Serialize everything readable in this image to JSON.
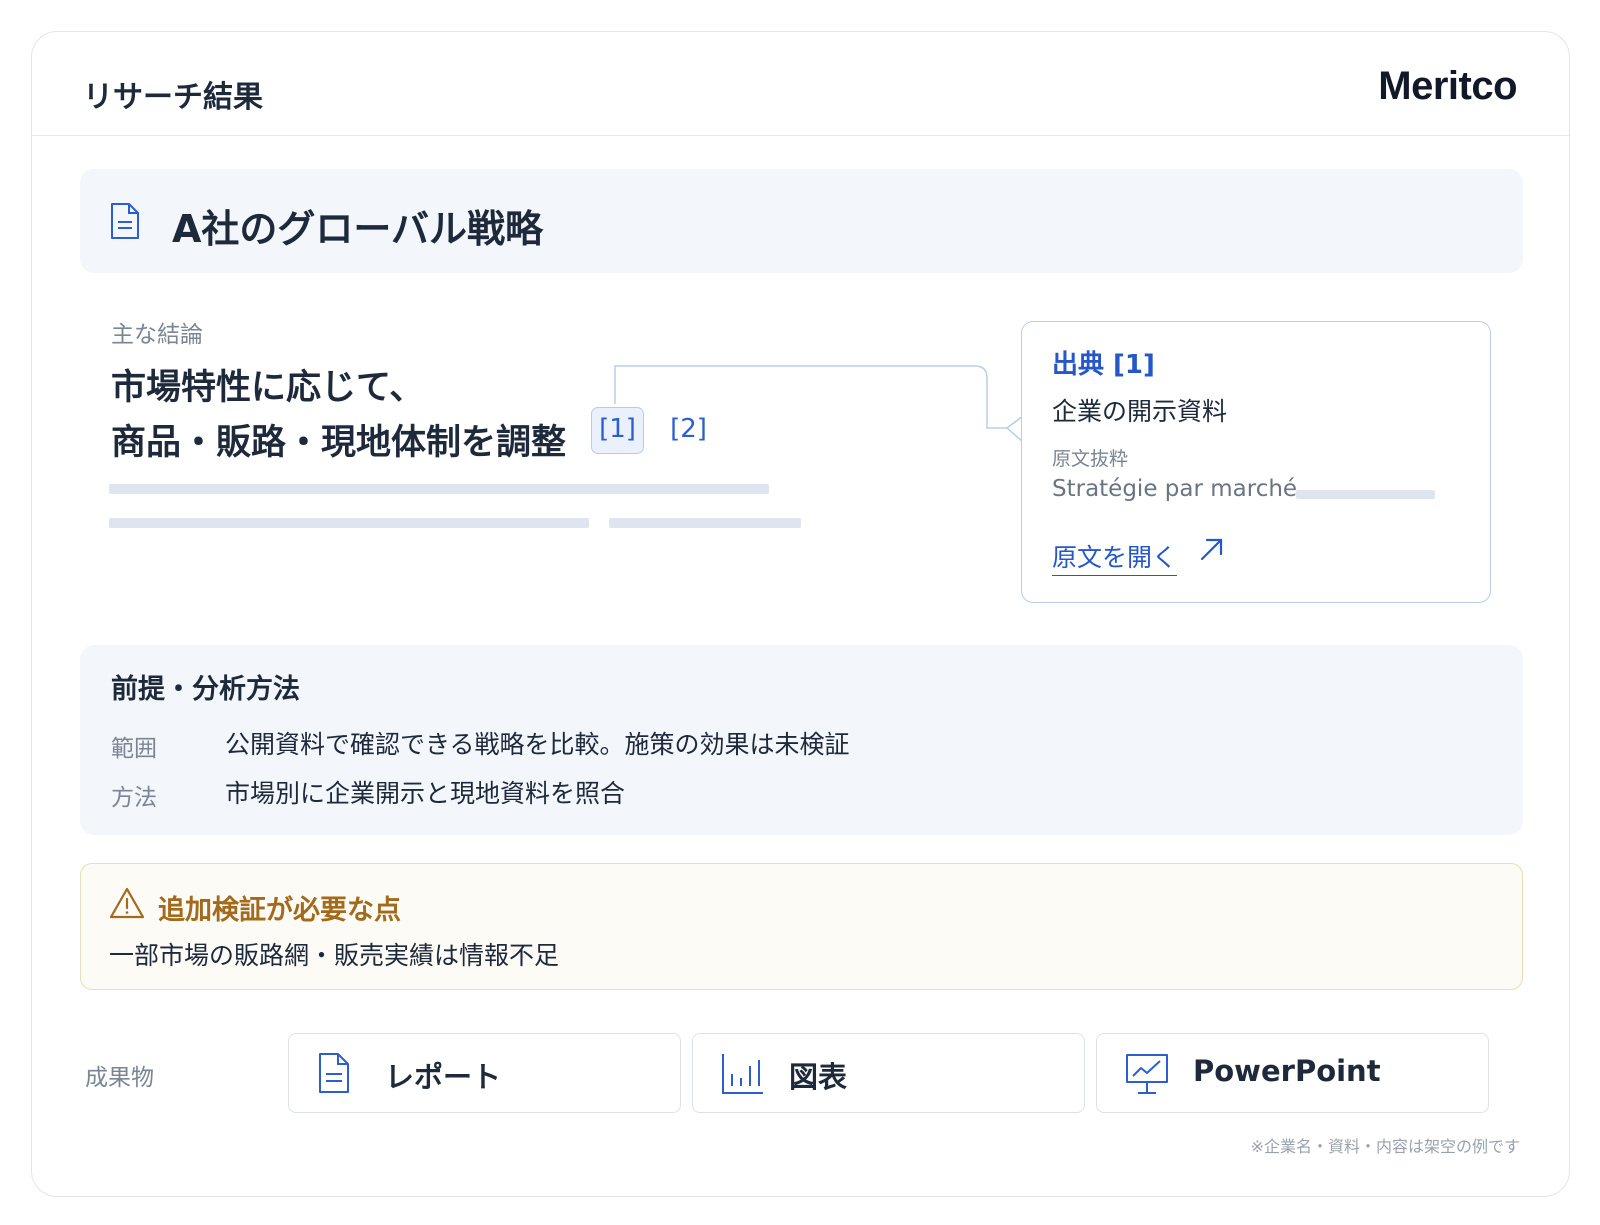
{
  "header": {
    "title": "リサーチ結果",
    "brand": "Meritco"
  },
  "document": {
    "title": "A社のグローバル戦略",
    "icon": "document-icon"
  },
  "conclusion": {
    "label": "主な結論",
    "line1": "市場特性に応じて、",
    "line2": "商品・販路・現地体制を調整",
    "citations": [
      "[1]",
      "[2]"
    ]
  },
  "source": {
    "title": "出典 [1]",
    "name": "企業の開示資料",
    "excerpt_label": "原文抜粋",
    "excerpt": "Stratégie par marché",
    "open_link": "原文を開く",
    "open_icon": "external-link-arrow-icon"
  },
  "method": {
    "title": "前提・分析方法",
    "rows": [
      {
        "key": "範囲",
        "value": "公開資料で確認できる戦略を比較。施策の効果は未検証"
      },
      {
        "key": "方法",
        "value": "市場別に企業開示と現地資料を照合"
      }
    ]
  },
  "warning": {
    "title": "追加検証が必要な点",
    "text": "一部市場の販路網・販売実績は情報不足",
    "icon": "warning-triangle-icon"
  },
  "deliverables": {
    "label": "成果物",
    "items": [
      {
        "label": "レポート",
        "icon": "document-icon"
      },
      {
        "label": "図表",
        "icon": "bar-chart-icon"
      },
      {
        "label": "PowerPoint",
        "icon": "presentation-icon"
      }
    ]
  },
  "footnote": "※企業名・資料・内容は架空の例です",
  "colors": {
    "accent": "#2557c9",
    "warning": "#a36a1c",
    "panel_bg": "#f3f6fb"
  }
}
